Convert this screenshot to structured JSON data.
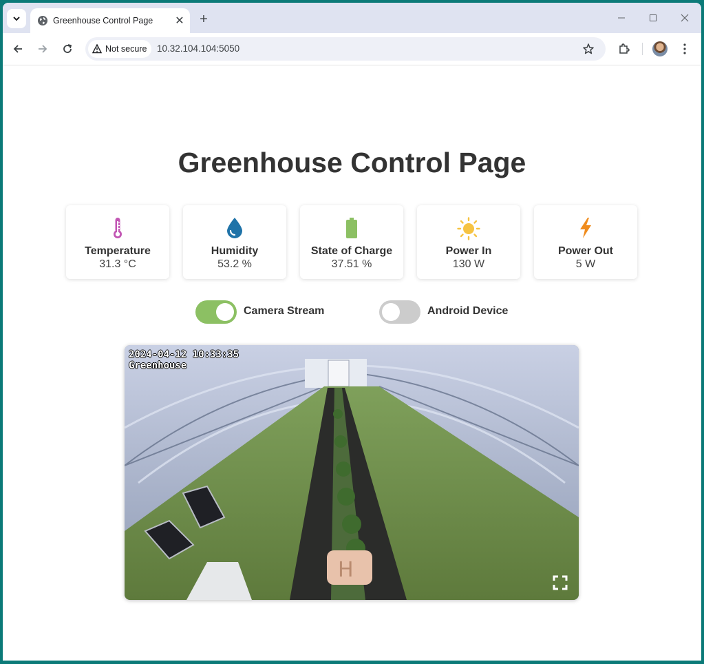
{
  "browser": {
    "tab_title": "Greenhouse Control Page",
    "security_label": "Not secure",
    "url": "10.32.104.104:5050"
  },
  "page": {
    "title": "Greenhouse Control Page"
  },
  "metrics": [
    {
      "label": "Temperature",
      "value": "31.3 °C",
      "icon": "thermometer-icon",
      "color": "#c256b4"
    },
    {
      "label": "Humidity",
      "value": "53.2 %",
      "icon": "water-drop-icon",
      "color": "#1f73a8"
    },
    {
      "label": "State of Charge",
      "value": "37.51 %",
      "icon": "battery-icon",
      "color": "#8cc063"
    },
    {
      "label": "Power In",
      "value": "130 W",
      "icon": "sun-icon",
      "color": "#f6c342"
    },
    {
      "label": "Power Out",
      "value": "5 W",
      "icon": "bolt-icon",
      "color": "#f08c1e"
    }
  ],
  "toggles": [
    {
      "label": "Camera Stream",
      "on": true,
      "color_on": "#8cc063"
    },
    {
      "label": "Android Device",
      "on": false,
      "color_off": "#cccccc"
    }
  ],
  "camera": {
    "timestamp": "2024-04-12 10:33:35",
    "location": "Greenhouse"
  }
}
